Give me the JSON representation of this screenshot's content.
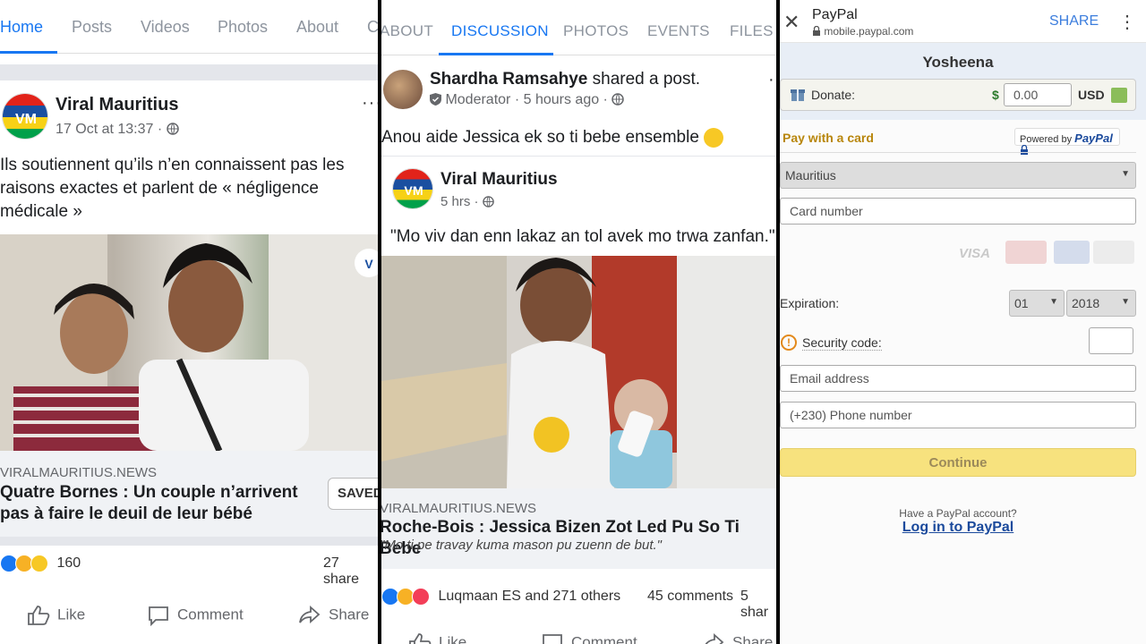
{
  "panel1": {
    "tabs": [
      "Home",
      "Posts",
      "Videos",
      "Photos",
      "About",
      "C"
    ],
    "page_name": "Viral Mauritius",
    "timestamp": "17 Oct at 13:37 ·",
    "post_text": "Ils soutiennent qu’ils n’en connaissent pas les raisons exactes et parlent de « négligence médicale »",
    "link_domain": "VIRALMAURITIUS.NEWS",
    "link_title": "Quatre Bornes : Un couple n’arrivent pas à faire le deuil de leur bébé",
    "saved_label": "SAVED",
    "reaction_count": "160",
    "shares": "27 share",
    "actions": {
      "like": "Like",
      "comment": "Comment",
      "share": "Share"
    }
  },
  "panel2": {
    "tabs": [
      "ABOUT",
      "DISCUSSION",
      "PHOTOS",
      "EVENTS",
      "FILES"
    ],
    "poster_name": "Shardha Ramsahye",
    "shared_text": "shared a post.",
    "role": "Moderator",
    "time": "· 5 hours ago ·",
    "post_text": "Anou aide Jessica ek so ti bebe ensemble",
    "inner_page": "Viral Mauritius",
    "inner_time": "5 hrs ·",
    "quote": "\"Mo viv dan enn lakaz an tol avek mo trwa zanfan.\"",
    "link_domain": "VIRALMAURITIUS.NEWS",
    "link_title": "Roche-Bois : Jessica Bizen Zot Led Pu So Ti Bebe",
    "link_sub": "\"Mo ti pe travay kuma mason pu zuenn de but.\"",
    "reactions": "Luqmaan ES and 271 others",
    "comments": "45 comments",
    "shares": "5 shar",
    "actions": {
      "like": "Like",
      "comment": "Comment",
      "share": "Share"
    }
  },
  "paypal": {
    "title": "PayPal",
    "url": "mobile.paypal.com",
    "share": "SHARE",
    "merchant": "Yosheena",
    "donate_label": "Donate:",
    "currency_symbol": "$",
    "amount": "0.00",
    "currency": "USD",
    "pay_with_card": "Pay with a card",
    "powered_by": "Powered by",
    "powered_brand": "PayPal",
    "country": "Mauritius",
    "card_number_placeholder": "Card number",
    "card_brand": "VISA",
    "expiration_label": "Expiration:",
    "exp_month": "01",
    "exp_year": "2018",
    "security_label": "Security code:",
    "email_placeholder": "Email address",
    "phone_placeholder": "(+230) Phone number",
    "continue": "Continue",
    "have_account": "Have a PayPal account?",
    "login": "Log in to PayPal"
  },
  "colors": {
    "facebook_blue": "#1877f2",
    "paypal_blue": "#1b4a9c",
    "continue_yellow": "#f7e27e"
  }
}
